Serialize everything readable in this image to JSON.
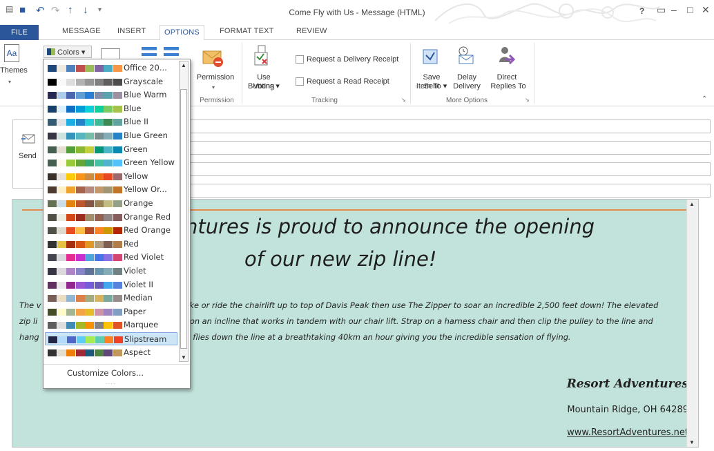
{
  "window": {
    "title": "Come Fly with Us - Message (HTML)",
    "help": "?",
    "controls": [
      "▭",
      "–",
      "□",
      "✕"
    ]
  },
  "tabs": [
    {
      "label": "FILE"
    },
    {
      "label": "MESSAGE"
    },
    {
      "label": "INSERT"
    },
    {
      "label": "OPTIONS"
    },
    {
      "label": "FORMAT TEXT"
    },
    {
      "label": "REVIEW"
    }
  ],
  "ribbon": {
    "themes": "Themes",
    "colors": "Colors ▾",
    "permission": "Permission",
    "permission_group": "Permission",
    "voting_line1": "Use Voting",
    "voting_line2": "Buttons ▾",
    "delivery_receipt": "Request a Delivery Receipt",
    "read_receipt": "Request a Read Receipt",
    "tracking_group": "Tracking",
    "save_sent_line1": "Save Sent",
    "save_sent_line2": "Item To ▾",
    "delay_line1": "Delay",
    "delay_line2": "Delivery",
    "direct_line1": "Direct",
    "direct_line2": "Replies To",
    "more_options_group": "More Options"
  },
  "compose": {
    "send": "Send"
  },
  "colors_menu": {
    "items": [
      {
        "name": "Office 20...",
        "swatches": [
          "#1f497d",
          "#eeece1",
          "#4f81bd",
          "#c0504d",
          "#9bbb59",
          "#8064a2",
          "#4bacc6",
          "#f79646"
        ]
      },
      {
        "name": "Grayscale",
        "swatches": [
          "#000000",
          "#f8f8f8",
          "#dddddd",
          "#b2b2b2",
          "#969696",
          "#808080",
          "#5f5f5f",
          "#4d4d4d"
        ]
      },
      {
        "name": "Blue Warm",
        "swatches": [
          "#242852",
          "#acccea",
          "#4a66ac",
          "#629dd1",
          "#297fd5",
          "#7f8fa9",
          "#5aa2ae",
          "#9d90a0"
        ]
      },
      {
        "name": "Blue",
        "swatches": [
          "#17406d",
          "#dbefff",
          "#0f6fc6",
          "#009dd9",
          "#0bd0d9",
          "#10cf9b",
          "#7cca62",
          "#a5c249"
        ]
      },
      {
        "name": "Blue II",
        "swatches": [
          "#335b74",
          "#dfe3e5",
          "#1cade4",
          "#2683c6",
          "#27ced7",
          "#42ba97",
          "#3e8853",
          "#62a39f"
        ]
      },
      {
        "name": "Blue Green",
        "swatches": [
          "#373545",
          "#cee3e0",
          "#3494ba",
          "#58b6c0",
          "#75bda7",
          "#7a8c8e",
          "#84acb6",
          "#2683c6"
        ]
      },
      {
        "name": "Green",
        "swatches": [
          "#455f51",
          "#e3ded1",
          "#549e39",
          "#8ab833",
          "#c0cf3a",
          "#029676",
          "#4ab5c4",
          "#0989b1"
        ]
      },
      {
        "name": "Green Yellow",
        "swatches": [
          "#455f51",
          "#fdf8e7",
          "#99cb38",
          "#63a537",
          "#37a76f",
          "#44c1a3",
          "#4eb3cf",
          "#51c3f9"
        ]
      },
      {
        "name": "Yellow",
        "swatches": [
          "#39302a",
          "#e5dedb",
          "#ffca08",
          "#f8931d",
          "#ce8d3e",
          "#ec7016",
          "#e64823",
          "#9c6a6a"
        ]
      },
      {
        "name": "Yellow Or...",
        "swatches": [
          "#4e3b30",
          "#fbeec9",
          "#f0a22e",
          "#a5644e",
          "#b58b80",
          "#c3986d",
          "#a19574",
          "#c17529"
        ]
      },
      {
        "name": "Orange",
        "swatches": [
          "#637052",
          "#ccddea",
          "#e48312",
          "#bd582c",
          "#865640",
          "#9b8357",
          "#c2bc80",
          "#94a088"
        ]
      },
      {
        "name": "Orange Red",
        "swatches": [
          "#505046",
          "#eeece1",
          "#d34817",
          "#9b2d1f",
          "#a28e6a",
          "#956251",
          "#918485",
          "#855d5d"
        ]
      },
      {
        "name": "Red Orange",
        "swatches": [
          "#505046",
          "#dedace",
          "#e84c22",
          "#ffbd47",
          "#b64926",
          "#ff8427",
          "#cc9900",
          "#b22600"
        ]
      },
      {
        "name": "Red",
        "swatches": [
          "#323232",
          "#e5c243",
          "#a5300f",
          "#d55816",
          "#e19825",
          "#b19c7d",
          "#7f5f52",
          "#b27d49"
        ]
      },
      {
        "name": "Red Violet",
        "swatches": [
          "#454551",
          "#d8d9dc",
          "#e32d91",
          "#c830cc",
          "#4ea6dc",
          "#4775e7",
          "#8971e1",
          "#d54773"
        ]
      },
      {
        "name": "Violet",
        "swatches": [
          "#373545",
          "#dcd8dc",
          "#ad84c6",
          "#8784c7",
          "#5d739a",
          "#6997af",
          "#84acb6",
          "#6f8183"
        ]
      },
      {
        "name": "Violet II",
        "swatches": [
          "#632e62",
          "#eae5eb",
          "#92278f",
          "#9b57d3",
          "#755dd9",
          "#665eb8",
          "#45a5ed",
          "#5982db"
        ]
      },
      {
        "name": "Median",
        "swatches": [
          "#775f55",
          "#ebddc3",
          "#94b6d2",
          "#dd8047",
          "#a5ab81",
          "#d8b25c",
          "#7ba79d",
          "#968c8c"
        ]
      },
      {
        "name": "Paper",
        "swatches": [
          "#444d26",
          "#fefac9",
          "#a5b592",
          "#f3a447",
          "#e7bc29",
          "#d092a7",
          "#9c85c0",
          "#809ec2"
        ]
      },
      {
        "name": "Marquee",
        "swatches": [
          "#5e5e5e",
          "#dddddd",
          "#418ab3",
          "#a6b727",
          "#f69200",
          "#838383",
          "#fec306",
          "#df5327"
        ]
      },
      {
        "name": "Slipstream",
        "swatches": [
          "#212745",
          "#b4dcfa",
          "#4e67c8",
          "#5eccf3",
          "#a7ea52",
          "#5dceaf",
          "#ff8021",
          "#f14124"
        ]
      },
      {
        "name": "Aspect",
        "swatches": [
          "#323232",
          "#e3ded1",
          "#f07f09",
          "#9f2936",
          "#1b587c",
          "#4e8542",
          "#604878",
          "#c19859"
        ]
      }
    ],
    "customize": "Customize Colors..."
  },
  "message": {
    "headline_line1": "ntures is proud to announce the opening",
    "headline_line2": "of our new zip line!",
    "para_line1_left": "The v",
    "para_line1_right": "hike or ride the chairlift up to top of Davis Peak then use The Zipper to soar an incredible 2,500 feet down! The elevated",
    "para_line2_left": "zip li",
    "para_line2_right": "d on an incline that works in tandem with our chair lift.  Strap on a harness chair and then clip the pulley to the line and",
    "para_line3_left": "hang",
    "para_line3_right": "er flies down the line at a breathtaking 40km an hour giving you the incredible sensation of flying.",
    "signature_name": "Resort Adventures",
    "signature_address": "Mountain Ridge, OH 64289",
    "signature_url": "www.ResortAdventures.net"
  }
}
